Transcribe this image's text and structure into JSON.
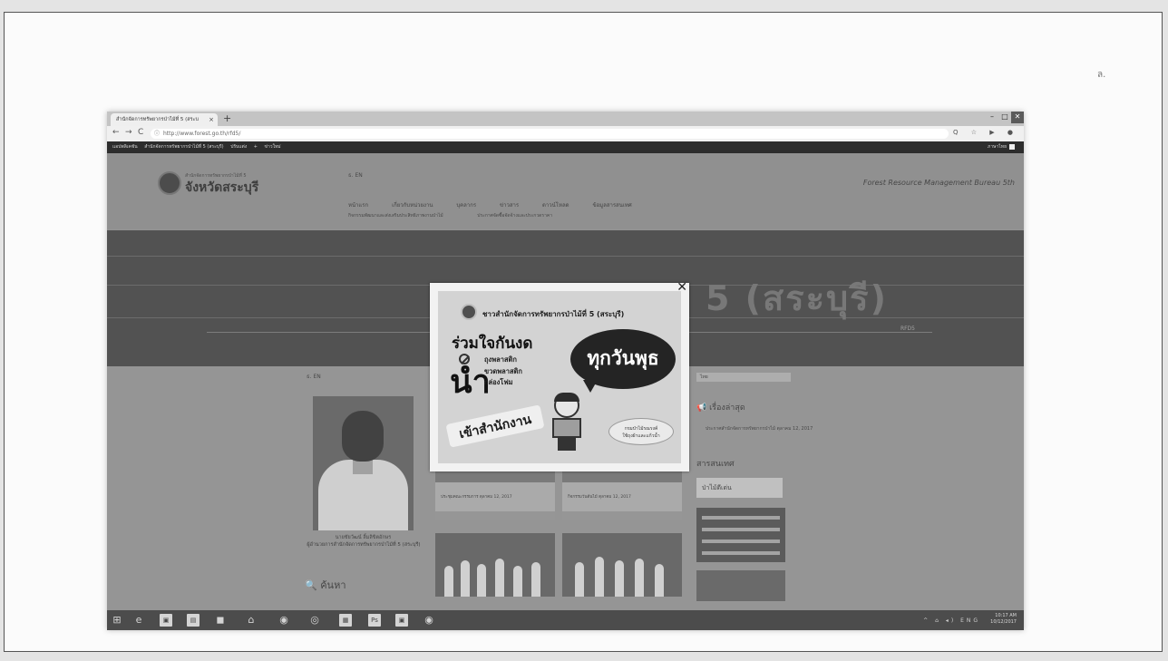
{
  "page": {
    "corner_mark": "ล."
  },
  "browser": {
    "tab_title": "สำนักจัดการทรัพยากรป่าไม้ที่ 5 (สระบ",
    "tab_close": "×",
    "new_tab": "+",
    "window_controls": [
      "–",
      "□",
      "✕"
    ],
    "nav": {
      "back": "←",
      "forward": "→",
      "reload": "C"
    },
    "address_icon": "ⓘ",
    "address": "http://www.forest.go.th/rfd5/",
    "toolbar_icons": "Q ☆ ▶ ●",
    "bookmarks": [
      "แอปพลิเคชัน",
      "สำนักจัดการทรัพยากรป่าไม้ที่ 5 (สระบุรี)",
      "ปรับแต่ง",
      "+",
      "ข่าวใหม่"
    ],
    "bookmarks_right": "ภาษาไทย"
  },
  "site": {
    "logo_small": "สำนักจัดการทรัพยากรป่าไม้ที่ 5",
    "logo_title": "จังหวัดสระบุรี",
    "lang": "ธ. EN",
    "slogan": "Forest Resource Management Bureau 5th",
    "menu": [
      "หน้าแรก",
      "เกี่ยวกับหน่วยงาน",
      "บุคลากร",
      "ข่าวสาร",
      "ดาวน์โหลด",
      "ข้อมูลสารสนเทศ"
    ],
    "submenu": [
      "กิจกรรมพัฒนาและส่งเสริมประสิทธิภาพงานป่าไม้",
      "ประกาศจัดซื้อจัดจ้างและประกวดราคา"
    ],
    "banner_text": "5 (สระบุรี)",
    "banner_mini": "RFD5",
    "col_lang": "ธ. EN",
    "director_name": "นายชัยวัฒน์ ลิ้มลิขิตอักษร",
    "director_role": "ผู้อำนวยการสำนักจัดการทรัพยากรป่าไม้ที่ 5 (สระบุรี)",
    "search_label": "🔍 ค้นหา",
    "cards": [
      {
        "meta": "ประชุมคณะกรรมการ ตุลาคม 12, 2017"
      },
      {
        "meta": "กิจกรรมวันต้นไม้ ตุลาคม 12, 2017"
      }
    ],
    "right": {
      "select_label": "ไทย",
      "news_heading": "📢 เรื่องล่าสุด",
      "news_item": "ประกาศสำนักจัดการทรัพยากรป่าไม้ ตุลาคม 12, 2017",
      "pr_heading": "สารสนเทศ",
      "banner1": "ป่าไม้ดีเด่น"
    }
  },
  "popup": {
    "close": "✕",
    "header": "ชาวสำนักจัดการทรัพยากรป่าไม้ที่ 5 (สระบุรี)",
    "line1": "ร่วมใจกันงด",
    "big": "นำ",
    "items": [
      "ถุงพลาสติก",
      "ขวดพลาสติก",
      "กล่องโฟม"
    ],
    "bubble": "ทุกวันพุธ",
    "office": "เข้าสำนักงาน",
    "badge": [
      "กรมป่าไม้รณรงค์",
      "ใช้ถุงผ้าและแก้วน้ำ"
    ]
  },
  "taskbar": {
    "start_icon": "⊞",
    "apps": [
      "e",
      "▣",
      "▤",
      "◼",
      "⌂",
      "◉",
      "◎",
      "▦",
      "Ps",
      "▣",
      "◉"
    ],
    "tray_icons": "^ ⌂ ◂) ENG",
    "time": "10:17 AM",
    "date": "10/12/2017"
  }
}
